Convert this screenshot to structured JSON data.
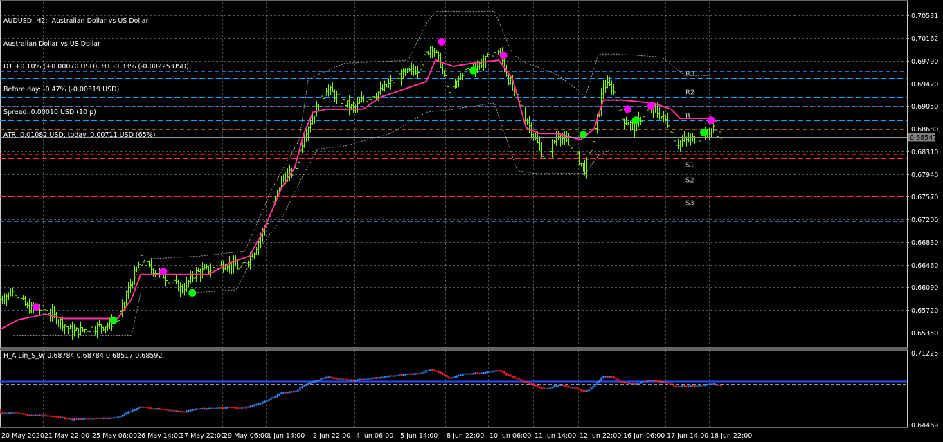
{
  "window": {
    "info_lines": [
      "AUDUSD, H2:  Australian Dollar vs US Dollar",
      "Australian Dollar vs US Dollar",
      "D1 +0.10% (+0.00070 USD), H1 -0.33% (-0.00225 USD)",
      "Before day: -0.47% (-0.00319 USD)",
      "Spread: 0.00010 USD (10 p)",
      "ATR: 0.01082 USD, today: 0.00711 USD (65%)"
    ],
    "indicator_title": "H_A Lin_S_W 0.68784 0.68784 0.68517 0.68592"
  },
  "colors": {
    "background": "#000000",
    "grid": "#c8c8c8",
    "bull_candle": "#7cfc00",
    "ma_line": "#ff3399",
    "band_line": "#c0c0c0",
    "marker_sell": "#ff00ff",
    "marker_buy": "#00ff00",
    "pivot_line": "#00aaff",
    "support_line": "#ff3333",
    "ha_up": "#3b8cff",
    "ha_down": "#ff2020",
    "current_price_bg": "#808080"
  },
  "chart_data": {
    "type": "line",
    "symbol": "AUDUSD",
    "timeframe": "H2",
    "y_ticks": [
      "0.70531",
      "0.70162",
      "0.69790",
      "0.69420",
      "0.69050",
      "0.68680",
      "0.68310",
      "0.67940",
      "0.67570",
      "0.67200",
      "0.66830",
      "0.66460",
      "0.66090",
      "0.65720",
      "0.65350"
    ],
    "ylim": [
      0.651,
      0.7075
    ],
    "current_price": "0.68547",
    "x_ticks": [
      "20 May 2020",
      "21 May 22:00",
      "25 May 06:00",
      "26 May 14:00",
      "27 May 22:00",
      "29 May 06:00",
      "1 Jun 14:00",
      "2 Jun 22:00",
      "4 Jun 06:00",
      "5 Jun 14:00",
      "8 Jun 22:00",
      "10 Jun 06:00",
      "11 Jun 14:00",
      "12 Jun 22:00",
      "16 Jun 06:00",
      "17 Jun 14:00",
      "18 Jun 22:00"
    ],
    "pivots": [
      {
        "label": "R3",
        "value": 0.6951
      },
      {
        "label": "R2",
        "value": 0.692
      },
      {
        "label": "R",
        "value": 0.6882
      },
      {
        "label": "S1",
        "value": 0.682
      },
      {
        "label": "S2",
        "value": 0.6795
      },
      {
        "label": "S3",
        "value": 0.6757
      }
    ],
    "price_keypoints": [
      [
        0,
        0.659
      ],
      [
        0.015,
        0.6603
      ],
      [
        0.03,
        0.6575
      ],
      [
        0.05,
        0.6572
      ],
      [
        0.065,
        0.6555
      ],
      [
        0.08,
        0.6536
      ],
      [
        0.1,
        0.6542
      ],
      [
        0.12,
        0.6548
      ],
      [
        0.13,
        0.6556
      ],
      [
        0.14,
        0.66
      ],
      [
        0.155,
        0.6655
      ],
      [
        0.165,
        0.664
      ],
      [
        0.18,
        0.6628
      ],
      [
        0.2,
        0.6605
      ],
      [
        0.215,
        0.6632
      ],
      [
        0.235,
        0.664
      ],
      [
        0.25,
        0.6648
      ],
      [
        0.265,
        0.664
      ],
      [
        0.28,
        0.6668
      ],
      [
        0.295,
        0.672
      ],
      [
        0.31,
        0.6785
      ],
      [
        0.325,
        0.68
      ],
      [
        0.335,
        0.686
      ],
      [
        0.345,
        0.689
      ],
      [
        0.36,
        0.6935
      ],
      [
        0.375,
        0.6915
      ],
      [
        0.39,
        0.69
      ],
      [
        0.4,
        0.6915
      ],
      [
        0.42,
        0.693
      ],
      [
        0.44,
        0.6955
      ],
      [
        0.46,
        0.6965
      ],
      [
        0.475,
        0.7005
      ],
      [
        0.485,
        0.6975
      ],
      [
        0.495,
        0.692
      ],
      [
        0.51,
        0.696
      ],
      [
        0.525,
        0.697
      ],
      [
        0.54,
        0.6985
      ],
      [
        0.55,
        0.6995
      ],
      [
        0.56,
        0.695
      ],
      [
        0.575,
        0.69
      ],
      [
        0.59,
        0.685
      ],
      [
        0.6,
        0.682
      ],
      [
        0.615,
        0.686
      ],
      [
        0.63,
        0.6835
      ],
      [
        0.645,
        0.68
      ],
      [
        0.655,
        0.6855
      ],
      [
        0.665,
        0.694
      ],
      [
        0.675,
        0.6935
      ],
      [
        0.685,
        0.6885
      ],
      [
        0.7,
        0.687
      ],
      [
        0.71,
        0.6895
      ],
      [
        0.72,
        0.69
      ],
      [
        0.735,
        0.688
      ],
      [
        0.745,
        0.6845
      ],
      [
        0.76,
        0.685
      ],
      [
        0.775,
        0.6855
      ],
      [
        0.785,
        0.687
      ],
      [
        0.795,
        0.6855
      ]
    ],
    "ma_keypoints": [
      [
        0,
        0.654
      ],
      [
        0.02,
        0.6556
      ],
      [
        0.05,
        0.6565
      ],
      [
        0.07,
        0.6558
      ],
      [
        0.13,
        0.6558
      ],
      [
        0.145,
        0.659
      ],
      [
        0.155,
        0.663
      ],
      [
        0.19,
        0.663
      ],
      [
        0.23,
        0.663
      ],
      [
        0.255,
        0.665
      ],
      [
        0.275,
        0.666
      ],
      [
        0.29,
        0.67
      ],
      [
        0.31,
        0.677
      ],
      [
        0.325,
        0.6805
      ],
      [
        0.335,
        0.686
      ],
      [
        0.345,
        0.6895
      ],
      [
        0.36,
        0.69
      ],
      [
        0.4,
        0.69
      ],
      [
        0.42,
        0.692
      ],
      [
        0.44,
        0.693
      ],
      [
        0.47,
        0.6945
      ],
      [
        0.48,
        0.698
      ],
      [
        0.5,
        0.697
      ],
      [
        0.52,
        0.6975
      ],
      [
        0.55,
        0.698
      ],
      [
        0.565,
        0.695
      ],
      [
        0.58,
        0.687
      ],
      [
        0.595,
        0.686
      ],
      [
        0.615,
        0.686
      ],
      [
        0.64,
        0.685
      ],
      [
        0.655,
        0.6868
      ],
      [
        0.665,
        0.6915
      ],
      [
        0.685,
        0.6915
      ],
      [
        0.72,
        0.691
      ],
      [
        0.74,
        0.69
      ],
      [
        0.75,
        0.6885
      ],
      [
        0.785,
        0.6885
      ],
      [
        0.79,
        0.688
      ]
    ],
    "upper_band_keypoints": [
      [
        0,
        0.66
      ],
      [
        0.08,
        0.66
      ],
      [
        0.14,
        0.66
      ],
      [
        0.16,
        0.6655
      ],
      [
        0.22,
        0.666
      ],
      [
        0.27,
        0.6668
      ],
      [
        0.3,
        0.677
      ],
      [
        0.33,
        0.685
      ],
      [
        0.34,
        0.695
      ],
      [
        0.38,
        0.6975
      ],
      [
        0.45,
        0.698
      ],
      [
        0.47,
        0.704
      ],
      [
        0.48,
        0.706
      ],
      [
        0.53,
        0.706
      ],
      [
        0.545,
        0.706
      ],
      [
        0.565,
        0.699
      ],
      [
        0.58,
        0.6975
      ],
      [
        0.61,
        0.696
      ],
      [
        0.63,
        0.694
      ],
      [
        0.645,
        0.692
      ],
      [
        0.66,
        0.699
      ],
      [
        0.68,
        0.699
      ],
      [
        0.73,
        0.6985
      ],
      [
        0.755,
        0.6955
      ],
      [
        0.785,
        0.6955
      ]
    ],
    "lower_band_keypoints": [
      [
        0.015,
        0.653
      ],
      [
        0.1,
        0.653
      ],
      [
        0.145,
        0.653
      ],
      [
        0.155,
        0.66
      ],
      [
        0.21,
        0.66
      ],
      [
        0.26,
        0.6605
      ],
      [
        0.28,
        0.666
      ],
      [
        0.31,
        0.672
      ],
      [
        0.33,
        0.678
      ],
      [
        0.35,
        0.6835
      ],
      [
        0.38,
        0.684
      ],
      [
        0.43,
        0.686
      ],
      [
        0.47,
        0.6895
      ],
      [
        0.5,
        0.69
      ],
      [
        0.545,
        0.691
      ],
      [
        0.57,
        0.68
      ],
      [
        0.59,
        0.6795
      ],
      [
        0.63,
        0.6795
      ],
      [
        0.645,
        0.6795
      ],
      [
        0.66,
        0.6825
      ],
      [
        0.675,
        0.6835
      ],
      [
        0.72,
        0.6835
      ],
      [
        0.745,
        0.6835
      ]
    ],
    "sell_markers": [
      [
        0.04,
        0.6577
      ],
      [
        0.18,
        0.6635
      ],
      [
        0.487,
        0.701
      ],
      [
        0.555,
        0.6988
      ],
      [
        0.692,
        0.69
      ],
      [
        0.718,
        0.6905
      ],
      [
        0.784,
        0.6882
      ]
    ],
    "buy_markers": [
      [
        0.125,
        0.6555
      ],
      [
        0.212,
        0.66
      ],
      [
        0.522,
        0.6963
      ],
      [
        0.643,
        0.6858
      ],
      [
        0.701,
        0.6882
      ],
      [
        0.776,
        0.6862
      ]
    ],
    "indicator": {
      "name": "H_A Lin_S_W",
      "values": [
        "0.68784",
        "0.68784",
        "0.68517",
        "0.68592"
      ],
      "y_ticks": [
        "0.71225",
        "0.64469"
      ]
    }
  }
}
